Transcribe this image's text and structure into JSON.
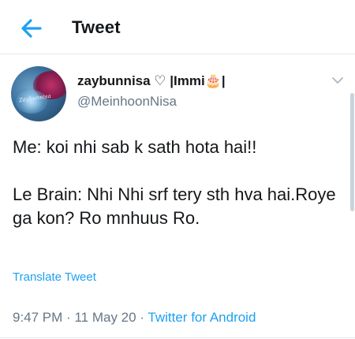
{
  "header": {
    "title": "Tweet",
    "back_icon": "arrow-left-icon",
    "accent": "#1da1f2"
  },
  "tweet": {
    "display_name": "zaybunnisa ♡ |Immi🎂|",
    "handle": "@MeinhoonNisa",
    "avatar_text": "Zaybunnisa",
    "text_line1": "Me: koi nhi sab k sath hota hai!!",
    "text_line2": "Le Brain: Nhi Nhi srf tery sth hva hai.Roye ga kon? Ro mnhuus Ro.",
    "translate_label": "Translate Tweet",
    "time": "9:47 PM",
    "separator": "·",
    "date": "11 May 20",
    "source": "Twitter for Android",
    "more_icon": "chevron-down-icon"
  },
  "colors": {
    "text": "#14171a",
    "secondary": "#657786",
    "link": "#1da1f2"
  }
}
